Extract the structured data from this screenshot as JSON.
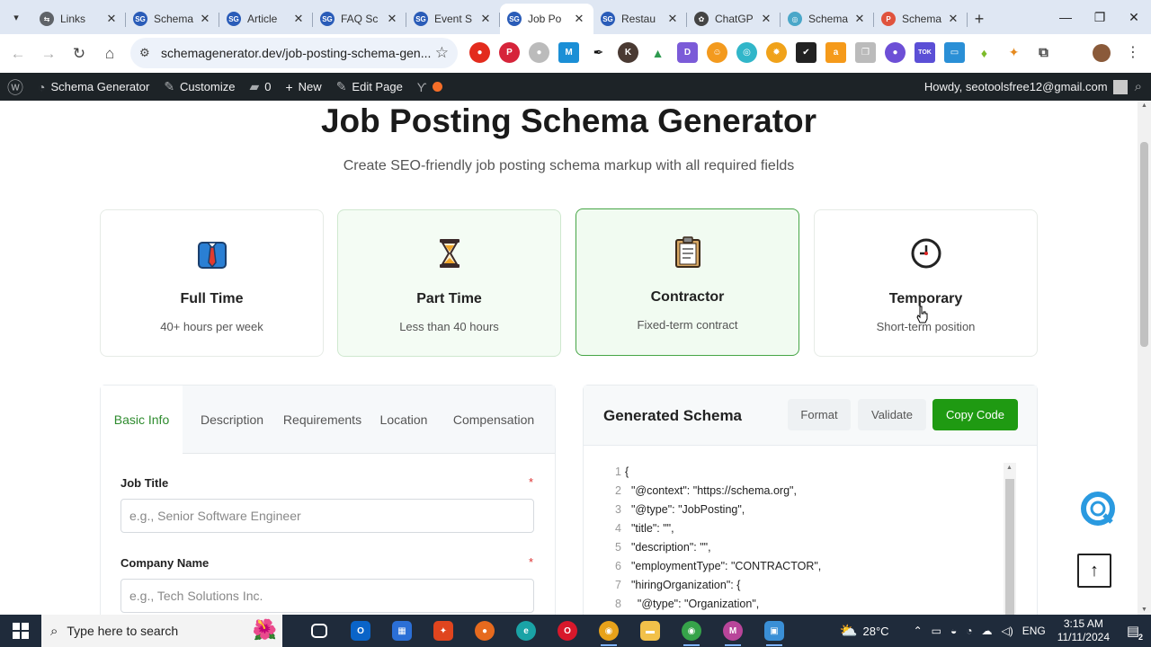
{
  "browser": {
    "tabs": [
      {
        "label": "Links",
        "favicon": "link-icon",
        "color": "#5f6368",
        "active": false
      },
      {
        "label": "Schema",
        "favicon": "sg-icon",
        "color": "#2a5cb8",
        "active": false
      },
      {
        "label": "Article",
        "favicon": "sg-icon",
        "color": "#2a5cb8",
        "active": false
      },
      {
        "label": "FAQ Sc",
        "favicon": "sg-icon",
        "color": "#2a5cb8",
        "active": false
      },
      {
        "label": "Event S",
        "favicon": "sg-icon",
        "color": "#2a5cb8",
        "active": false
      },
      {
        "label": "Job Po",
        "favicon": "sg-icon",
        "color": "#2a5cb8",
        "active": true
      },
      {
        "label": "Restau",
        "favicon": "sg-icon",
        "color": "#2a5cb8",
        "active": false
      },
      {
        "label": "ChatGP",
        "favicon": "chatgpt-icon",
        "color": "#444444",
        "active": false
      },
      {
        "label": "Schema",
        "favicon": "globe-icon",
        "color": "#4aa7c9",
        "active": false
      },
      {
        "label": "Schema",
        "favicon": "p-icon",
        "color": "#e0533d",
        "active": false
      }
    ],
    "url": "schemagenerator.dev/job-posting-schema-gen..."
  },
  "wpbar": {
    "site_name": "Schema Generator",
    "customize": "Customize",
    "comments_count": "0",
    "new_label": "New",
    "edit_page": "Edit Page",
    "howdy": "Howdy, seotoolsfree12@gmail.com"
  },
  "page": {
    "title": "Job Posting Schema Generator",
    "subtitle": "Create SEO-friendly job posting schema markup with all required fields",
    "job_types": [
      {
        "name": "Full Time",
        "desc": "40+ hours per week",
        "icon": "necktie-icon"
      },
      {
        "name": "Part Time",
        "desc": "Less than 40 hours",
        "icon": "hourglass-icon"
      },
      {
        "name": "Contractor",
        "desc": "Fixed-term contract",
        "icon": "clipboard-icon"
      },
      {
        "name": "Temporary",
        "desc": "Short-term position",
        "icon": "clock-icon"
      }
    ],
    "form_tabs": [
      "Basic Info",
      "Description",
      "Requirements",
      "Location",
      "Compensation"
    ],
    "fields": [
      {
        "label": "Job Title",
        "placeholder": "e.g., Senior Software Engineer",
        "required": "*"
      },
      {
        "label": "Company Name",
        "placeholder": "e.g., Tech Solutions Inc.",
        "required": "*"
      }
    ],
    "schema": {
      "title": "Generated Schema",
      "format_btn": "Format",
      "validate_btn": "Validate",
      "copy_btn": "Copy Code",
      "lines": [
        {
          "n": "1",
          "text": "{"
        },
        {
          "n": "2",
          "text": "  \"@context\": \"https://schema.org\","
        },
        {
          "n": "3",
          "text": "  \"@type\": \"JobPosting\","
        },
        {
          "n": "4",
          "text": "  \"title\": \"\","
        },
        {
          "n": "5",
          "text": "  \"description\": \"\","
        },
        {
          "n": "6",
          "text": "  \"employmentType\": \"CONTRACTOR\","
        },
        {
          "n": "7",
          "text": "  \"hiringOrganization\": {"
        },
        {
          "n": "8",
          "text": "    \"@type\": \"Organization\","
        }
      ]
    }
  },
  "taskbar": {
    "search_placeholder": "Type here to search",
    "temperature": "28°C",
    "lang": "ENG",
    "time": "3:15 AM",
    "date": "11/11/2024",
    "notification_count": "2"
  },
  "colors": {
    "accent_green": "#1f9a12",
    "tab_active_green": "#2e8b2e",
    "selected_card_border": "#46a546",
    "wp_bar": "#1d2327"
  }
}
